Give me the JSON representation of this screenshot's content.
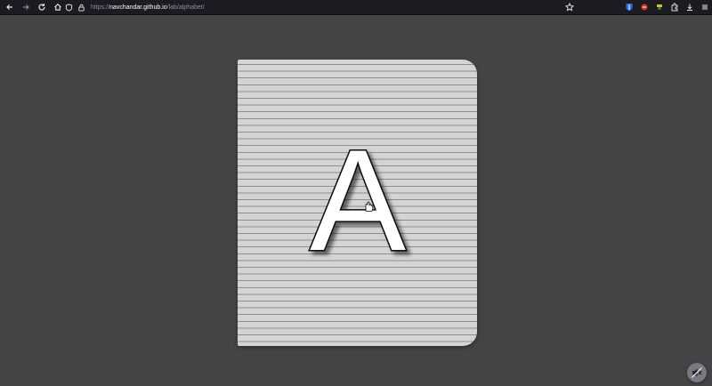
{
  "browser": {
    "url_scheme": "https://",
    "url_host": "navchandar.github.io",
    "url_path": "/lab/alphabet/",
    "icons": [
      "back-icon",
      "forward-icon",
      "reload-icon",
      "home-icon",
      "shield-icon",
      "lock-icon",
      "bookmark-star-icon",
      "bitwarden-icon",
      "red-extension-icon",
      "yellow-extension-icon",
      "extensions-icon",
      "downloads-icon",
      "menu-icon"
    ]
  },
  "app": {
    "current_letter": "A",
    "colors": {
      "background": "#444446",
      "page": "#d4d4d4",
      "page_lines": "#8e8e8e",
      "letter_fill": "#ffffff",
      "letter_outline": "#111111"
    }
  },
  "floating_button": {
    "icon": "mute-speaker-icon"
  }
}
